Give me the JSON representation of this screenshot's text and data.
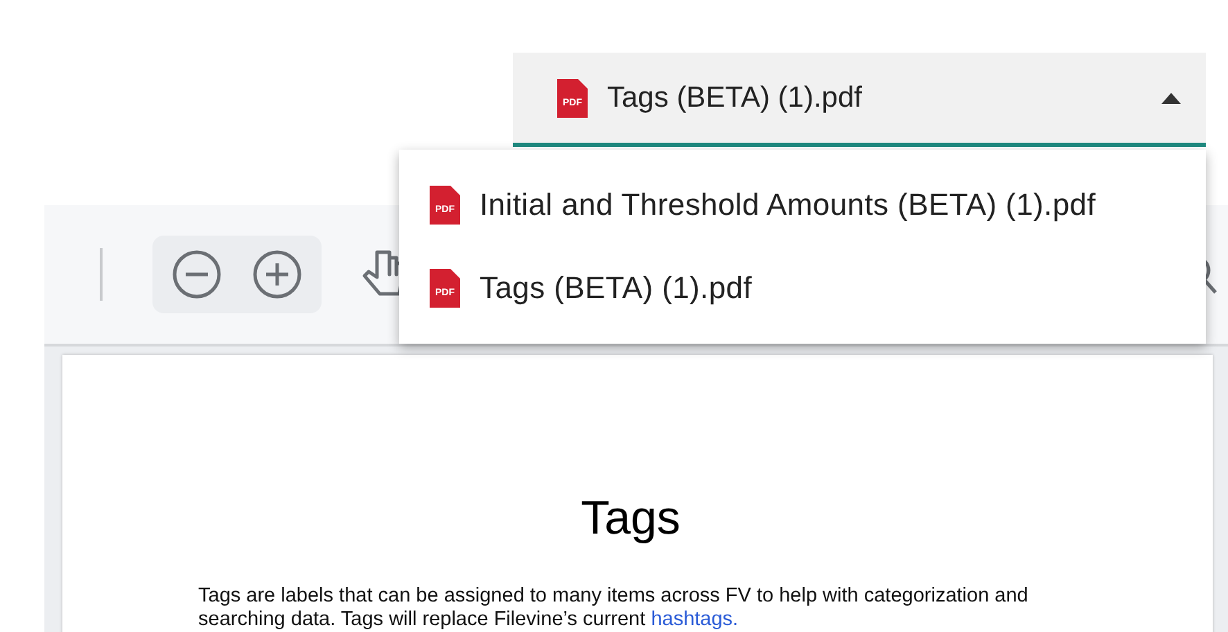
{
  "file_select": {
    "value": "Tags (BETA) (1).pdf",
    "icon_label": "PDF",
    "expanded": true
  },
  "file_menu": [
    {
      "label": "Initial and Threshold Amounts (BETA) (1).pdf",
      "icon_label": "PDF"
    },
    {
      "label": "Tags (BETA) (1).pdf",
      "icon_label": "PDF"
    }
  ],
  "document": {
    "title": "Tags",
    "paragraph": "Tags are labels that can be assigned to many items across FV to help with categorization and searching data. Tags will replace Filevine’s current",
    "link": "hashtags."
  }
}
